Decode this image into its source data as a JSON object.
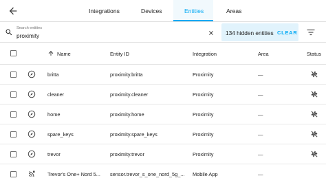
{
  "tabs": [
    {
      "label": "Integrations",
      "active": false
    },
    {
      "label": "Devices",
      "active": false
    },
    {
      "label": "Entities",
      "active": true
    },
    {
      "label": "Areas",
      "active": false
    }
  ],
  "search": {
    "label": "Search entities",
    "value": "proximity",
    "hidden_count": "134 hidden entities",
    "clear_label": "CLEAR"
  },
  "table": {
    "columns": [
      "Name",
      "Entity ID",
      "Integration",
      "Area",
      "Status"
    ],
    "rows": [
      {
        "name": "britta",
        "entity_id": "proximity.britta",
        "integration": "Proximity",
        "area": "—",
        "icon": "compass-icon"
      },
      {
        "name": "cleaner",
        "entity_id": "proximity.cleaner",
        "integration": "Proximity",
        "area": "—",
        "icon": "compass-icon"
      },
      {
        "name": "home",
        "entity_id": "proximity.home",
        "integration": "Proximity",
        "area": "—",
        "icon": "compass-icon"
      },
      {
        "name": "spare_keys",
        "entity_id": "proximity.spare_keys",
        "integration": "Proximity",
        "area": "—",
        "icon": "compass-icon"
      },
      {
        "name": "trevor",
        "entity_id": "proximity.trevor",
        "integration": "Proximity",
        "area": "—",
        "icon": "compass-icon"
      },
      {
        "name": "Trevor's One+ Nord 5...",
        "entity_id": "sensor.trevor_s_one_nord_5g_...",
        "integration": "Mobile App",
        "area": "—",
        "icon": "signal-icon"
      }
    ]
  },
  "colors": {
    "accent": "#03a9f4",
    "hidden_bg": "#e1f3fc",
    "text": "#212121"
  }
}
